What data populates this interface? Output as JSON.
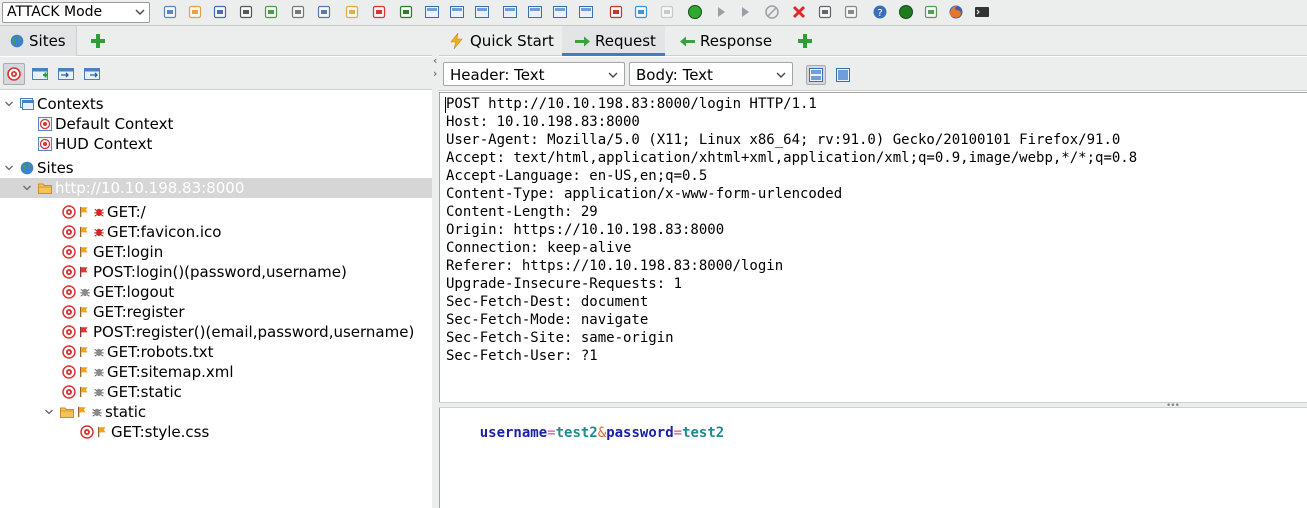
{
  "toolbar": {
    "mode": "ATTACK Mode",
    "icons": [
      "new-session-icon",
      "open-session-icon",
      "save-session-icon",
      "snapshot-icon",
      "session-properties-icon",
      "options-icon",
      "export-icon",
      "add-note-icon",
      "delete-icon",
      "hud-icon",
      "layout-full-icon",
      "layout-left-icon",
      "layout-top-icon",
      "layout-tabs-icon",
      "layout-wide-icon",
      "layout-expand-icon",
      "layout-side-icon",
      "addons-icon",
      "scripts-icon",
      "tips-icon",
      "proxy-on-icon",
      "step-icon",
      "continue-icon",
      "stop-icon",
      "drop-icon",
      "fuzzer-icon",
      "callbacks-icon",
      "help-icon",
      "online-icon",
      "notes-icon",
      "firefox-icon",
      "terminal-icon"
    ]
  },
  "left": {
    "tab_label": "Sites",
    "tree": [
      {
        "label": "Contexts",
        "level": 0,
        "icon": "contexts-icon",
        "expander": "expanded"
      },
      {
        "label": "Default Context",
        "level": 1,
        "icon": "context-target-icon"
      },
      {
        "label": "HUD Context",
        "level": 1,
        "icon": "context-target-icon"
      },
      {
        "label": "Sites",
        "level": 0,
        "icon": "globe-icon",
        "expander": "expanded"
      },
      {
        "label": "http://10.10.198.83:8000",
        "level": 1,
        "icon": "folder-icon",
        "expander": "expanded",
        "selected": true
      },
      {
        "label": "GET:/",
        "level": 2,
        "icon": "target-icon",
        "flags": [
          "flag-orange-icon",
          "bug-red-icon"
        ]
      },
      {
        "label": "GET:favicon.ico",
        "level": 2,
        "icon": "target-icon",
        "flags": [
          "flag-orange-icon",
          "bug-red-icon"
        ]
      },
      {
        "label": "GET:login",
        "level": 2,
        "icon": "target-icon",
        "flags": [
          "flag-orange-icon"
        ]
      },
      {
        "label": "POST:login()(password,username)",
        "level": 2,
        "icon": "target-icon",
        "flags": [
          "flag-red-icon"
        ]
      },
      {
        "label": "GET:logout",
        "level": 2,
        "icon": "target-icon",
        "flags": [
          "bug-grey-icon"
        ]
      },
      {
        "label": "GET:register",
        "level": 2,
        "icon": "target-icon",
        "flags": [
          "flag-orange-icon"
        ]
      },
      {
        "label": "POST:register()(email,password,username)",
        "level": 2,
        "icon": "target-icon",
        "flags": [
          "flag-red-icon"
        ]
      },
      {
        "label": "GET:robots.txt",
        "level": 2,
        "icon": "target-icon",
        "flags": [
          "flag-orange-icon",
          "bug-grey-icon"
        ]
      },
      {
        "label": "GET:sitemap.xml",
        "level": 2,
        "icon": "target-icon",
        "flags": [
          "flag-orange-icon",
          "bug-grey-icon"
        ]
      },
      {
        "label": "GET:static",
        "level": 2,
        "icon": "target-icon",
        "flags": [
          "flag-orange-icon",
          "bug-grey-icon"
        ]
      },
      {
        "label": "static",
        "level": 2,
        "icon": "folder-icon",
        "expander": "expanded",
        "flags": [
          "flag-orange-icon",
          "bug-grey-icon"
        ]
      },
      {
        "label": "GET:style.css",
        "level": 3,
        "icon": "target-icon",
        "flags": [
          "flag-orange-icon"
        ]
      }
    ]
  },
  "right": {
    "tabs": [
      {
        "label": "Quick Start",
        "icon": "lightning-icon"
      },
      {
        "label": "Request",
        "icon": "arrow-right-icon",
        "active": true
      },
      {
        "label": "Response",
        "icon": "arrow-left-icon"
      }
    ],
    "header_select": "Header: Text",
    "body_select": "Body: Text",
    "request_headers": [
      "POST http://10.10.198.83:8000/login HTTP/1.1",
      "Host: 10.10.198.83:8000",
      "User-Agent: Mozilla/5.0 (X11; Linux x86_64; rv:91.0) Gecko/20100101 Firefox/91.0",
      "Accept: text/html,application/xhtml+xml,application/xml;q=0.9,image/webp,*/*;q=0.8",
      "Accept-Language: en-US,en;q=0.5",
      "Content-Type: application/x-www-form-urlencoded",
      "Content-Length: 29",
      "Origin: https://10.10.198.83:8000",
      "Connection: keep-alive",
      "Referer: https://10.10.198.83:8000/login",
      "Upgrade-Insecure-Requests: 1",
      "Sec-Fetch-Dest: document",
      "Sec-Fetch-Mode: navigate",
      "Sec-Fetch-Site: same-origin",
      "Sec-Fetch-User: ?1"
    ],
    "body_params": [
      {
        "key": "username",
        "value": "test2"
      },
      {
        "key": "password",
        "value": "test2"
      }
    ],
    "body_eq": "=",
    "body_amp": "&"
  }
}
